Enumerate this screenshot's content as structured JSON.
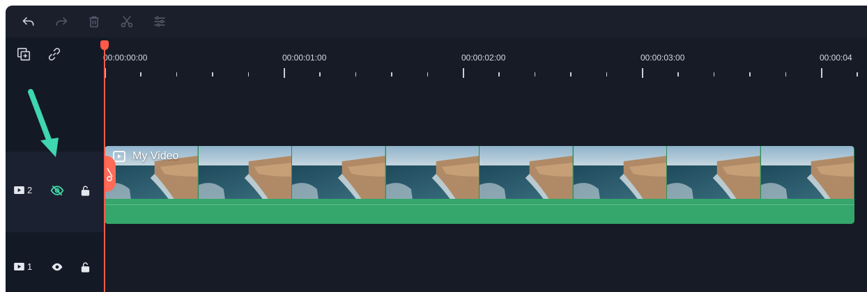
{
  "toolbar": {
    "icons": [
      "undo-icon",
      "redo-icon",
      "delete-icon",
      "cut-icon",
      "adjust-icon"
    ]
  },
  "track_header_tools": {
    "icons": [
      "add-track-icon",
      "link-icon"
    ]
  },
  "ruler": {
    "timecodes": [
      "00:00:00:00",
      "00:00:01:00",
      "00:00:02:00",
      "00:00:03:00",
      "00:00:04"
    ]
  },
  "tracks": [
    {
      "id": "2",
      "icon": "video-track-icon",
      "visibility_icon": "eye-hidden-icon",
      "lock_icon": "unlock-icon",
      "highlighted": true
    },
    {
      "id": "1",
      "icon": "video-track-icon",
      "visibility_icon": "eye-icon",
      "lock_icon": "unlock-icon",
      "highlighted": false
    }
  ],
  "clip": {
    "title": "My Video",
    "thumbnail_count": 8
  },
  "colors": {
    "background": "#161b26",
    "clip": "#35a66c",
    "playhead": "#ff5a4a",
    "accent_arrow": "#3fd6b0",
    "hidden_eye": "#3fd6a6"
  }
}
